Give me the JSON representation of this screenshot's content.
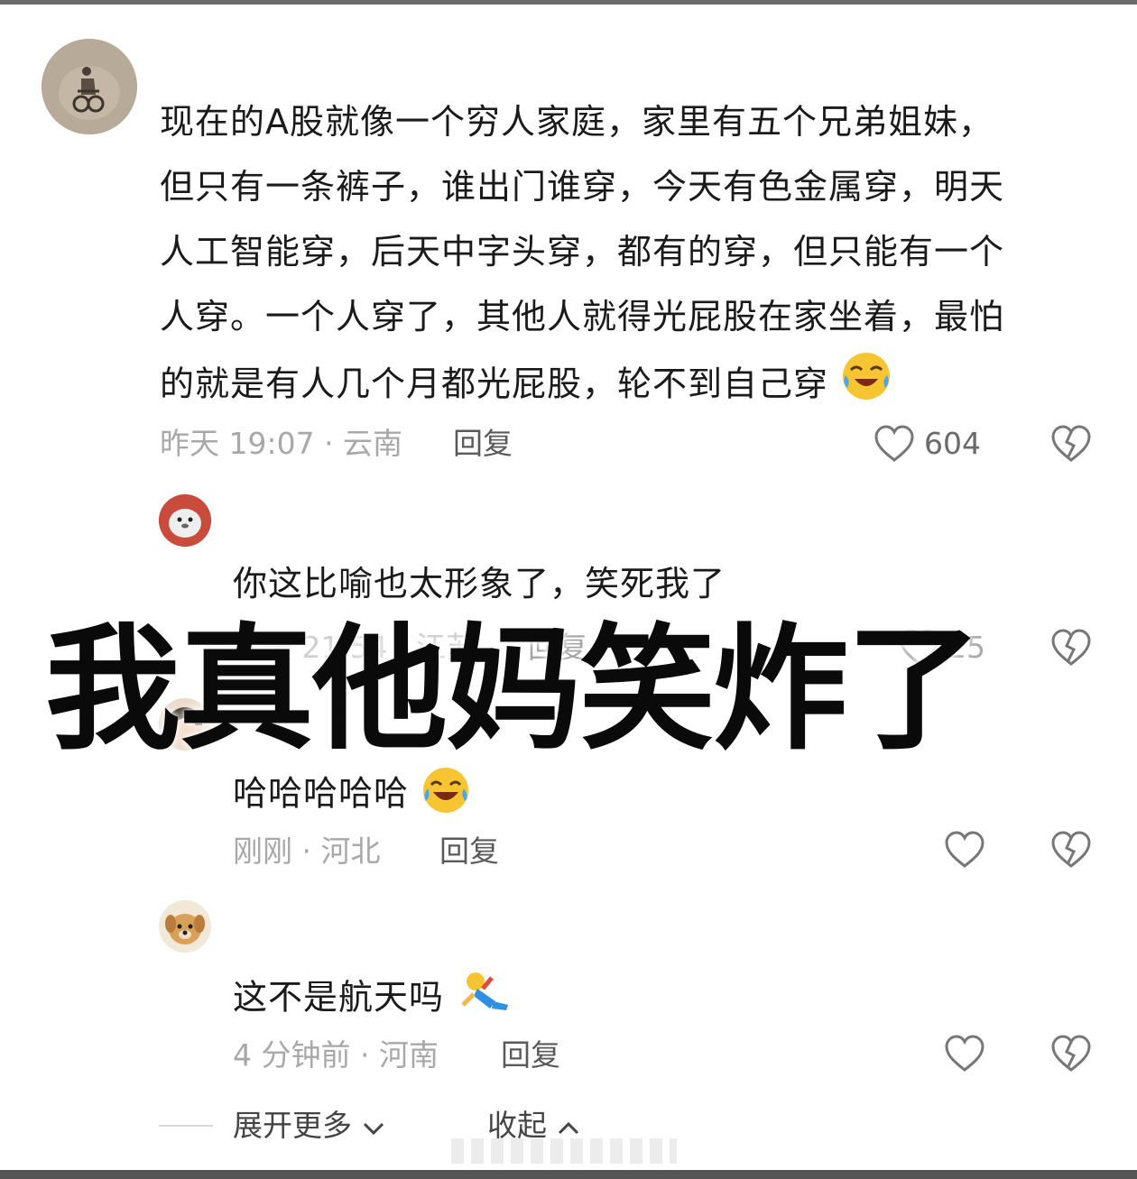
{
  "main_comment": {
    "lines": [
      "现在的A股就像一个穷人家庭，家里有五个兄弟姐妹，",
      "但只有一条裤子，谁出门谁穿，今天有色金属穿，明天",
      "人工智能穿，后天中字头穿，都有的穿，但只能有一个",
      "人穿。一个人穿了，其他人就得光屁股在家坐着，最怕",
      "的就是有人几个月都光屁股，轮不到自己穿"
    ],
    "emoji": "crying-laughing-emoji",
    "meta": "昨天 19:07 · 云南",
    "reply_label": "回复",
    "like_count": "604"
  },
  "replies": [
    {
      "text": "你这比喻也太形象了，笑死我了",
      "meta": "昨天 21:54 · 江苏",
      "reply_label": "回复",
      "like_count": "25"
    },
    {
      "text": "哈哈哈哈哈",
      "emoji": "tears-of-joy-emoji",
      "meta": "刚刚 · 河北",
      "reply_label": "回复"
    },
    {
      "text": "这不是航天吗",
      "emoji": "falling-figure-emoji",
      "meta": "4 分钟前 · 河南",
      "reply_label": "回复"
    }
  ],
  "overlay_caption": "我真他妈笑炸了",
  "footer": {
    "expand_label": "展开更多",
    "collapse_label": "收起"
  },
  "colors": {
    "text": "#1a1a1a",
    "meta": "#a8a8a8",
    "icon": "#777777"
  }
}
